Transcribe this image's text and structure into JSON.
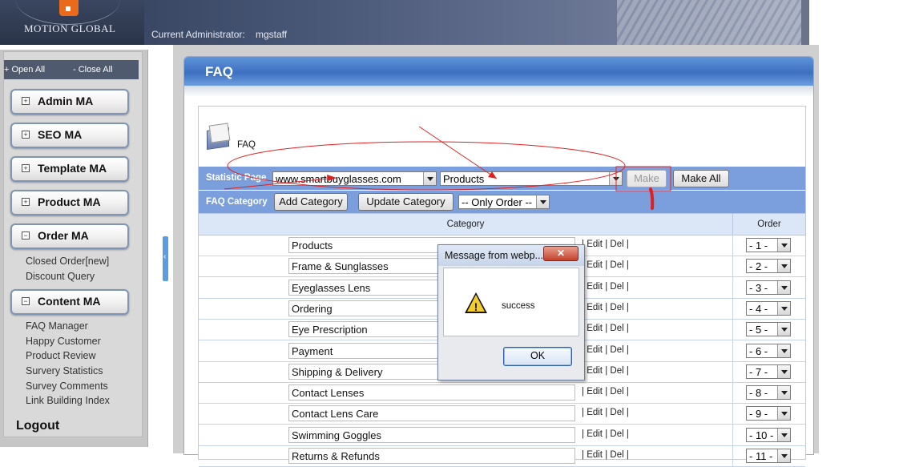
{
  "header": {
    "logo_text": "MOTION GLOBAL",
    "admin_label": "Current Administrator:",
    "admin_user": "mgstaff"
  },
  "sidebar": {
    "open_all": "+ Open All",
    "close_all": "- Close All",
    "menus": [
      {
        "label": "Admin MA",
        "expanded": false
      },
      {
        "label": "SEO MA",
        "expanded": false
      },
      {
        "label": "Template MA",
        "expanded": false
      },
      {
        "label": "Product MA",
        "expanded": false
      },
      {
        "label": "Order MA",
        "expanded": true
      },
      {
        "label": "Content MA",
        "expanded": true
      }
    ],
    "order_links": [
      "Closed Order[new]",
      "Discount Query"
    ],
    "content_links": [
      "FAQ Manager",
      "Happy Customer",
      "Product Review",
      "Survery Statistics",
      "Survey Comments",
      "Link Building Index"
    ],
    "logout": "Logout"
  },
  "page": {
    "title": "FAQ",
    "section_label": "FAQ"
  },
  "statistic": {
    "label": "Statistic Page",
    "site_select": "www.smartbuyglasses.com",
    "category_select": "Products",
    "make_button": "Make",
    "make_all_button": "Make All"
  },
  "faq_category": {
    "label": "FAQ Category",
    "add_button": "Add Category",
    "update_button": "Update Category",
    "order_select": "-- Only Order --"
  },
  "table": {
    "col_category": "Category",
    "col_order": "Order",
    "edit_label": "Edit",
    "del_label": "Del",
    "rows": [
      {
        "name": "Products",
        "order": "- 1 -"
      },
      {
        "name": "Frame & Sunglasses",
        "order": "- 2 -"
      },
      {
        "name": "Eyeglasses Lens",
        "order": "- 3 -"
      },
      {
        "name": "Ordering",
        "order": "- 4 -"
      },
      {
        "name": "Eye Prescription",
        "order": "- 5 -"
      },
      {
        "name": "Payment",
        "order": "- 6 -"
      },
      {
        "name": "Shipping & Delivery",
        "order": "- 7 -"
      },
      {
        "name": "Contact Lenses",
        "order": "- 8 -"
      },
      {
        "name": "Contact Lens Care",
        "order": "- 9 -"
      },
      {
        "name": "Swimming Goggles",
        "order": "- 10 -"
      },
      {
        "name": "Returns & Refunds",
        "order": "- 11 -"
      }
    ]
  },
  "dialog": {
    "title": "Message from webp...",
    "close_glyph": "✕",
    "message": "success",
    "ok_button": "OK"
  },
  "colors": {
    "annotation": "#e02020",
    "bar": "#7b9fdc",
    "title_bar": "#3d6fc0"
  }
}
